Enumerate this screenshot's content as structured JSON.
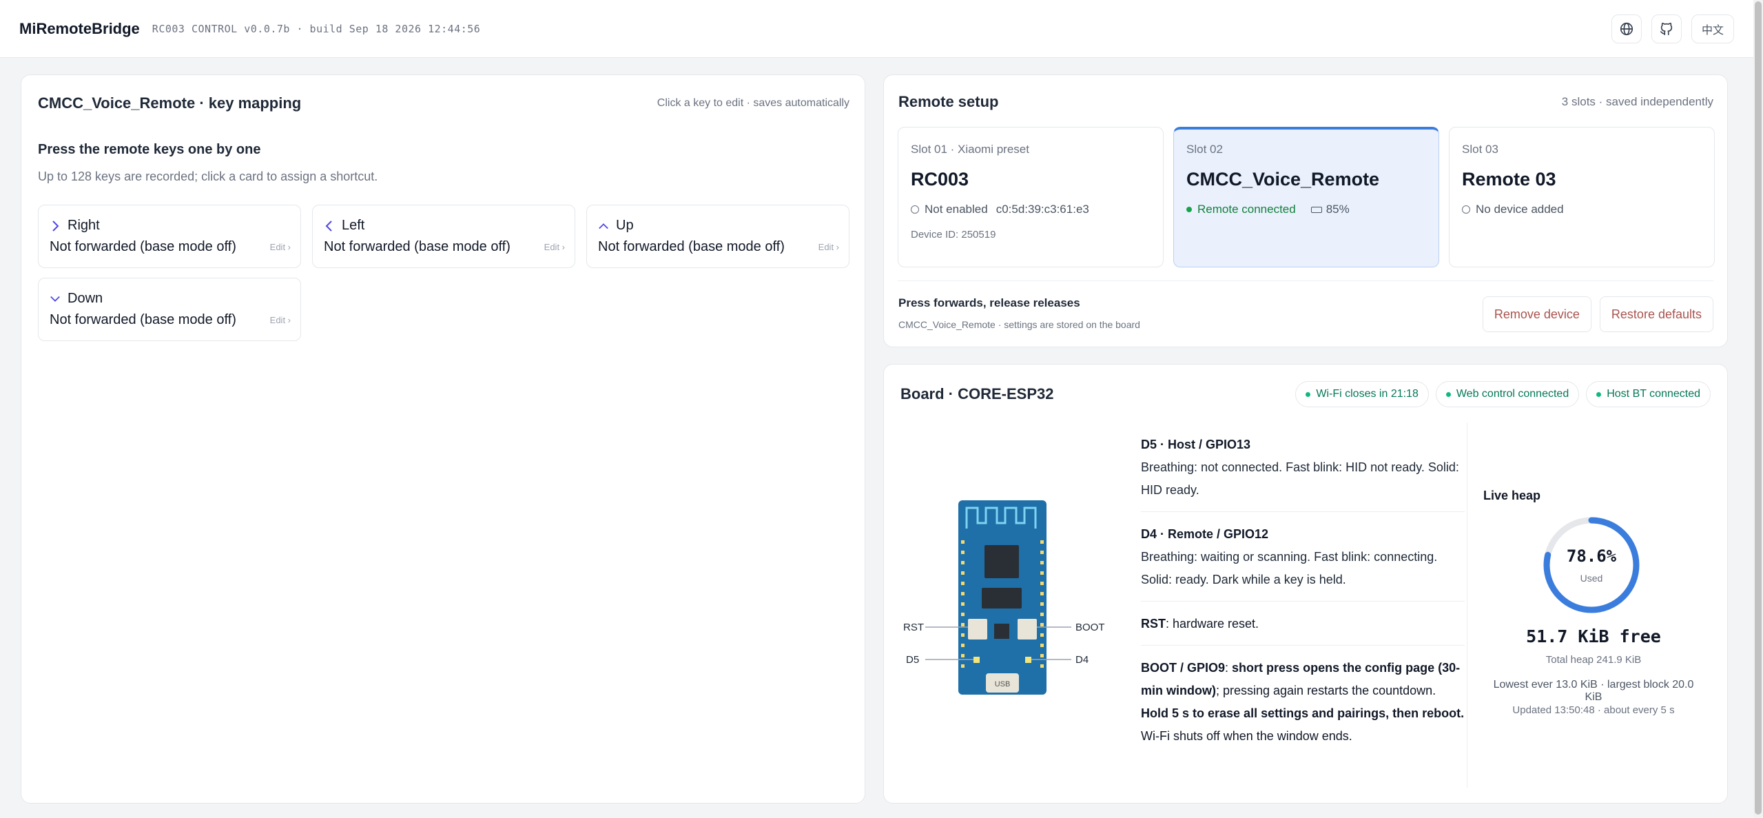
{
  "header": {
    "title": "MiRemoteBridge",
    "meta": "RC003 CONTROL  v0.0.7b · build Sep 18 2026 12:44:56",
    "lang_label": "中文"
  },
  "keymap": {
    "title": "CMCC_Voice_Remote · key mapping",
    "hint": "Click a key to edit · saves automatically",
    "subtitle": "Press the remote keys one by one",
    "description": "Up to 128 keys are recorded; click a card to assign a shortcut.",
    "keys": [
      {
        "icon": "chevron-right-icon",
        "name": "Right",
        "status": "Not forwarded (base mode off)",
        "edit": "Edit ›"
      },
      {
        "icon": "chevron-left-icon",
        "name": "Left",
        "status": "Not forwarded (base mode off)",
        "edit": "Edit ›"
      },
      {
        "icon": "chevron-up-icon",
        "name": "Up",
        "status": "Not forwarded (base mode off)",
        "edit": "Edit ›"
      },
      {
        "icon": "chevron-down-icon",
        "name": "Down",
        "status": "Not forwarded (base mode off)",
        "edit": "Edit ›"
      }
    ]
  },
  "remote_setup": {
    "title": "Remote setup",
    "hint": "3 slots · saved independently",
    "slots": [
      {
        "label": "Slot 01 · Xiaomi preset",
        "name": "RC003",
        "status": "Not enabled",
        "mac": "c0:5d:39:c3:61:e3",
        "device_id": "Device ID: 250519"
      },
      {
        "label": "Slot 02",
        "name": "CMCC_Voice_Remote",
        "status": "Remote connected",
        "battery": "85%"
      },
      {
        "label": "Slot 03",
        "name": "Remote 03",
        "status": "No device added"
      }
    ],
    "note_title": "Press forwards, release releases",
    "note_sub": "CMCC_Voice_Remote · settings are stored on the board",
    "remove_label": "Remove device",
    "restore_label": "Restore defaults",
    "accent_color": "#3b7ddd"
  },
  "board": {
    "title": "Board · CORE-ESP32",
    "badges": [
      "Wi-Fi closes in 21:18",
      "Web control connected",
      "Host BT connected"
    ],
    "diagram": {
      "rst": "RST",
      "d5": "D5",
      "boot": "BOOT",
      "d4": "D4",
      "usb": "USB"
    },
    "pins": {
      "d5_title": "D5 · Host / GPIO13",
      "d5_text": "Breathing: not connected. Fast blink: HID not ready. Solid: HID ready.",
      "d4_title": "D4 · Remote / GPIO12",
      "d4_text": "Breathing: waiting or scanning. Fast blink: connecting. Solid: ready. Dark while a key is held.",
      "rst_title": "RST",
      "rst_text": ": hardware reset.",
      "boot_title": "BOOT / GPIO9",
      "boot_sep": ": ",
      "boot_b1": "short press opens the config page (30-min window)",
      "boot_t1": "; pressing again restarts the countdown. ",
      "boot_b2": "Hold 5 s to erase all settings and pairings, then reboot.",
      "boot_t2": " Wi-Fi shuts off when the window ends."
    },
    "heap": {
      "title": "Live heap",
      "used_pct_value": 78.6,
      "used_pct": "78.6%",
      "used_label": "Used",
      "free": "51.7 KiB free",
      "total": "Total heap 241.9 KiB",
      "lowest": "Lowest ever 13.0 KiB · largest block 20.0 KiB",
      "updated": "Updated 13:50:48 · about every 5 s"
    }
  }
}
